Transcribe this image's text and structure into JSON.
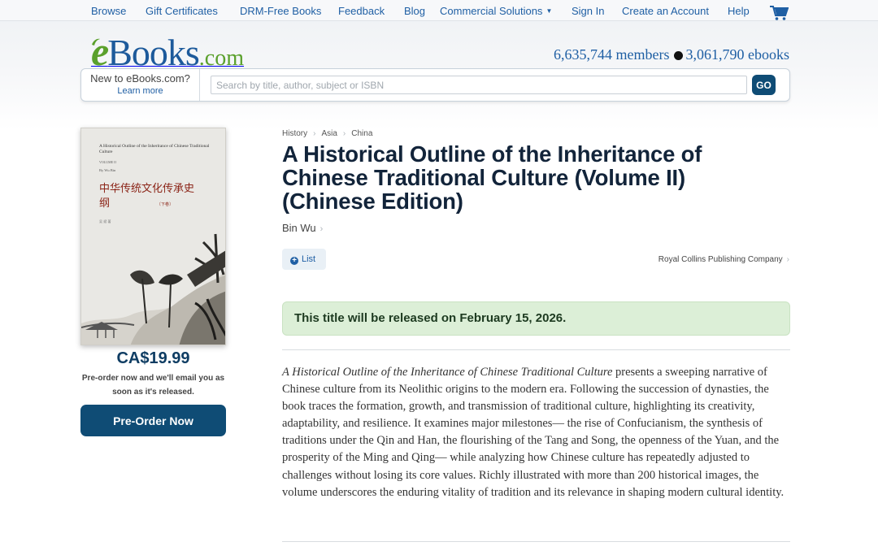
{
  "topnav": {
    "items": [
      "Browse",
      "Gift Certificates",
      "DRM-Free Books",
      "Feedback",
      "Blog",
      "Commercial Solutions",
      "Sign In",
      "Create an Account",
      "Help"
    ]
  },
  "header": {
    "logo": {
      "e": "e",
      "books": "Books",
      "com": ".com"
    },
    "members": "6,635,744 members",
    "ebooks": "3,061,790 ebooks",
    "newto": {
      "question": "New to eBooks.com?",
      "learn_more": "Learn more"
    },
    "search": {
      "placeholder": "Search by title, author, subject or ISBN",
      "value": "",
      "go_label": "GO"
    }
  },
  "cover": {
    "title_en": "A Historical Outline of the Inheritance of Chinese Traditional Culture",
    "volume": "VOLUME II",
    "by": "By Wu Bin",
    "title_zh": "中华传统文化传承史纲",
    "part": "〔下卷〕",
    "author_zh": "吴 斌 著"
  },
  "purchase": {
    "price": "CA$19.99",
    "note": "Pre-order now and we'll email you as soon as it's released.",
    "button": "Pre-Order Now"
  },
  "book": {
    "breadcrumbs": [
      "History",
      "Asia",
      "China"
    ],
    "title": "A Historical Outline of the Inheritance of Chinese Traditional Culture (Volume II) (Chinese Edition)",
    "author": "Bin Wu",
    "list_label": "List",
    "publisher": "Royal Collins Publishing Company",
    "release_notice": "This title will be released on February 15, 2026.",
    "description_title": "A Historical Outline of the Inheritance of Chinese Traditional Culture",
    "description_body": " presents a sweeping narrative of Chinese culture from its Neolithic origins to the modern era. Following the succession of dynasties, the book traces the formation, growth, and transmission of traditional culture, highlighting its creativity, adaptability, and resilience. It examines major milestones— the rise of Confucianism, the synthesis of traditions under the Qin and Han, the flourishing of the Tang and Song, the openness of the Yuan, and the prosperity of the Ming and Qing— while analyzing how Chinese culture has repeatedly adjusted to challenges without losing its core values. Richly illustrated with more than 200 historical images, the volume underscores the enduring vitality of tradition and its relevance in shaping modern cultural identity."
  },
  "icons": {
    "cart": "shopping-cart-icon",
    "dot": "bullet-dot",
    "list": "plus-circle-icon",
    "chevron": "chevron-right-icon"
  },
  "colors": {
    "brand_blue": "#0f4c75",
    "link_blue": "#1f5fa4",
    "logo_green": "#5aa02c",
    "notice_green": "#dcefd7"
  }
}
